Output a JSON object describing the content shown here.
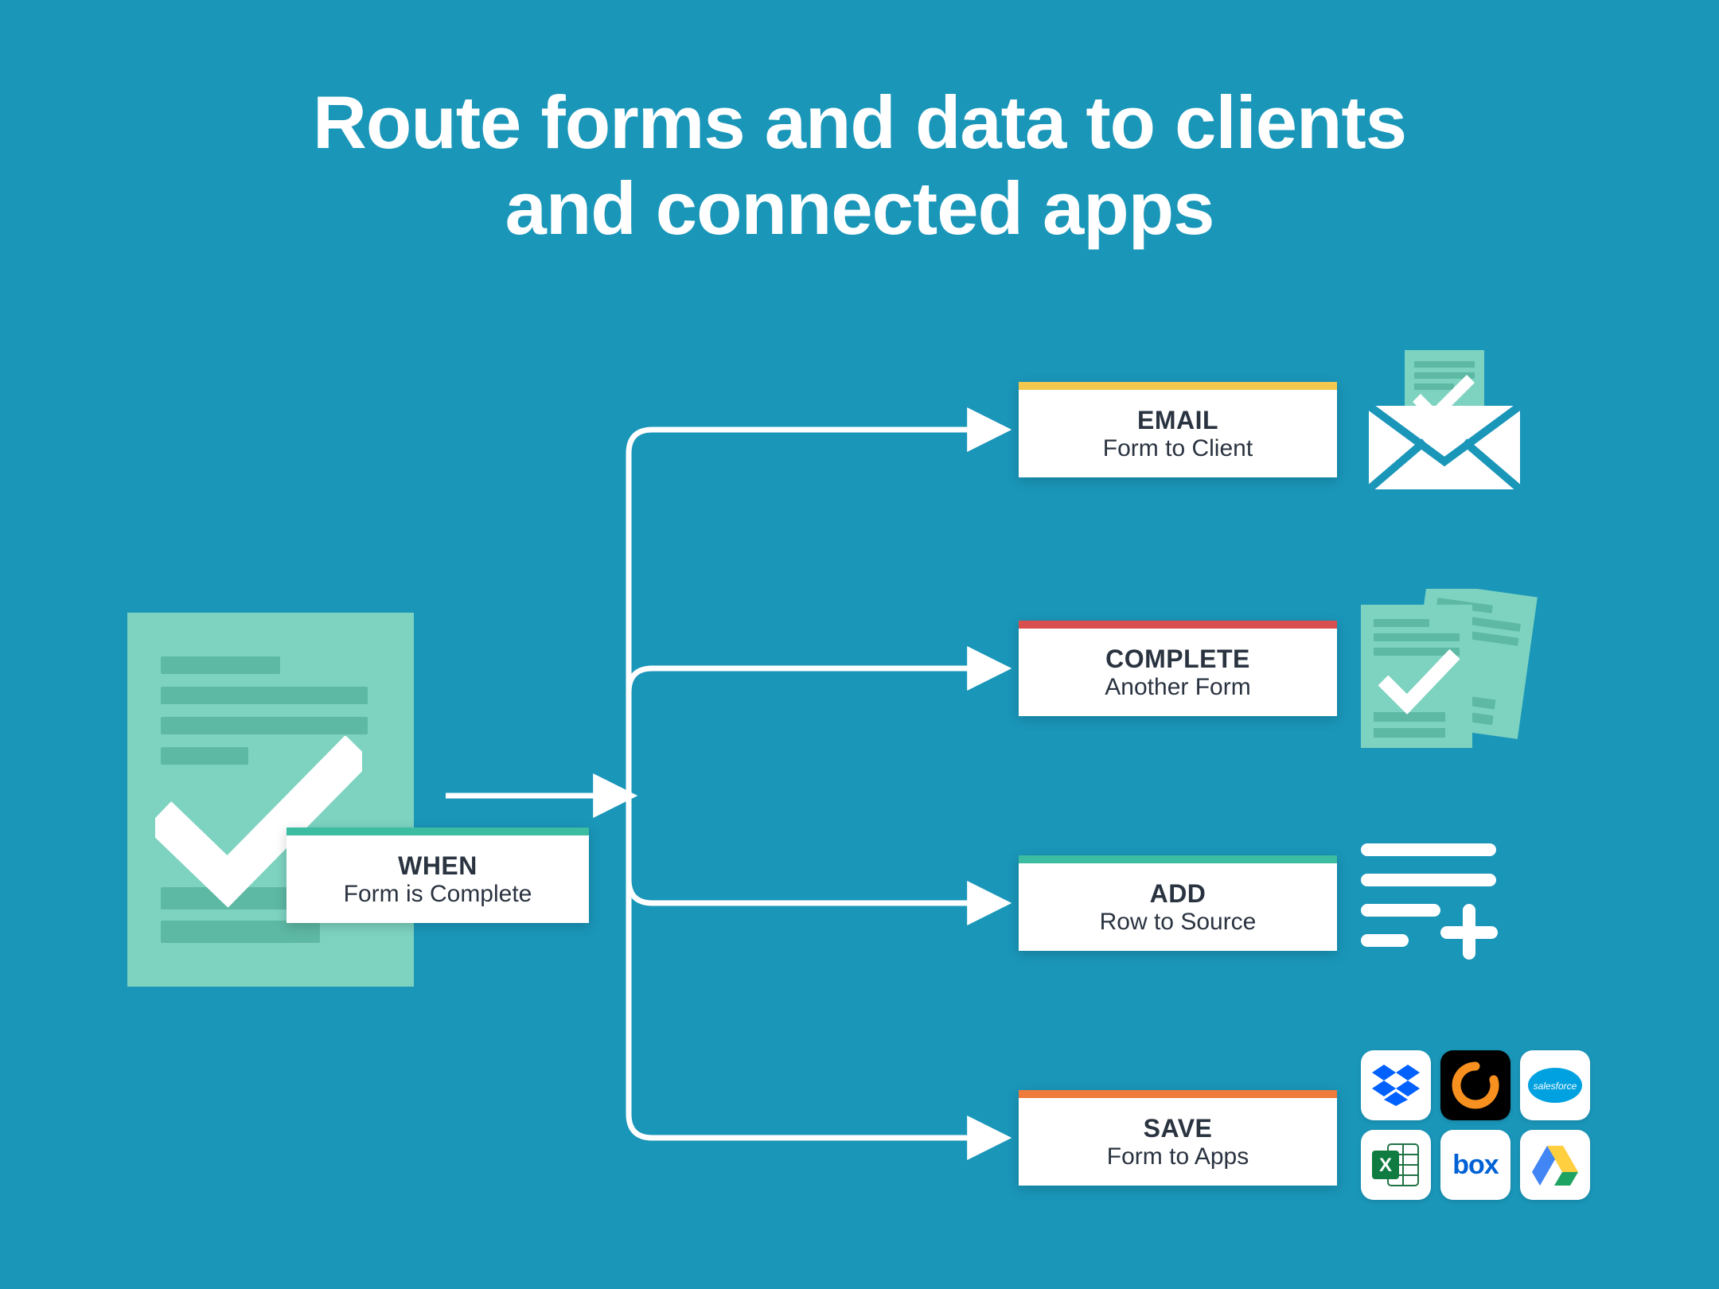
{
  "title_line1": "Route forms and data to clients",
  "title_line2": "and connected apps",
  "trigger": {
    "label": "WHEN",
    "sub": "Form is Complete"
  },
  "actions": [
    {
      "label": "EMAIL",
      "sub": "Form to Client",
      "accent": "#f4c84f",
      "icon": "envelope-check"
    },
    {
      "label": "COMPLETE",
      "sub": "Another Form",
      "accent": "#d94e4e",
      "icon": "forms-stack-check"
    },
    {
      "label": "ADD",
      "sub": "Row to Source",
      "accent": "#3cbca1",
      "icon": "list-plus"
    },
    {
      "label": "SAVE",
      "sub": "Form to Apps",
      "accent": "#ee7a3b",
      "icon": "app-grid"
    }
  ],
  "apps": [
    "dropbox",
    "conga",
    "salesforce",
    "excel",
    "box",
    "google-drive"
  ],
  "colors": {
    "bg": "#1a96b9",
    "mint": "#7dd3c0",
    "mint_dark": "#5db8a4",
    "text": "#2a3340"
  }
}
